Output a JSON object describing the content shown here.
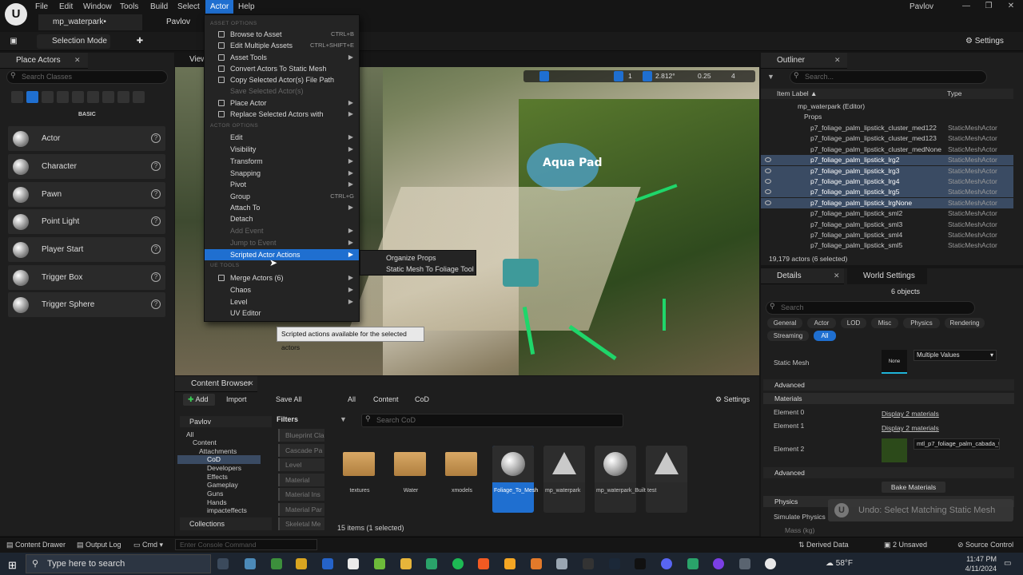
{
  "menubar": {
    "items": [
      "File",
      "Edit",
      "Window",
      "Tools",
      "Build",
      "Select",
      "Actor",
      "Help"
    ],
    "user": "Pavlov"
  },
  "tabs": {
    "level_tab": "mp_waterpark•",
    "project_tab": "Pavlov Work"
  },
  "toolbar": {
    "selection_mode": "Selection Mode",
    "settings": "Settings"
  },
  "place_actors": {
    "title": "Place Actors",
    "search_placeholder": "Search Classes",
    "category": "BASIC",
    "items": [
      "Actor",
      "Character",
      "Pawn",
      "Point Light",
      "Player Start",
      "Trigger Box",
      "Trigger Sphere"
    ]
  },
  "viewport": {
    "tab": "View",
    "snap_grid": "1",
    "angle": "2.812°",
    "scale": "0.25",
    "camera": "4"
  },
  "actor_menu": {
    "section_asset": "ASSET OPTIONS",
    "section_actor": "ACTOR OPTIONS",
    "section_ue": "UE TOOLS",
    "items": [
      {
        "label": "Browse to Asset",
        "shortcut": "CTRL+B"
      },
      {
        "label": "Edit Multiple Assets",
        "shortcut": "CTRL+SHIFT+E"
      },
      {
        "label": "Asset Tools",
        "shortcut": ""
      },
      {
        "label": "Convert Actors To Static Mesh",
        "shortcut": ""
      },
      {
        "label": "Copy Selected Actor(s) File Path",
        "shortcut": ""
      },
      {
        "label": "Save Selected Actor(s)",
        "shortcut": ""
      },
      {
        "label": "Place Actor",
        "shortcut": ""
      },
      {
        "label": "Replace Selected Actors with",
        "shortcut": ""
      },
      {
        "label": "Edit",
        "shortcut": ""
      },
      {
        "label": "Visibility",
        "shortcut": ""
      },
      {
        "label": "Transform",
        "shortcut": ""
      },
      {
        "label": "Snapping",
        "shortcut": ""
      },
      {
        "label": "Pivot",
        "shortcut": ""
      },
      {
        "label": "Group",
        "shortcut": "CTRL+G"
      },
      {
        "label": "Attach To",
        "shortcut": ""
      },
      {
        "label": "Detach",
        "shortcut": ""
      },
      {
        "label": "Add Event",
        "shortcut": ""
      },
      {
        "label": "Jump to Event",
        "shortcut": ""
      },
      {
        "label": "Scripted Actor Actions",
        "shortcut": ""
      },
      {
        "label": "Merge Actors (6)",
        "shortcut": ""
      },
      {
        "label": "Chaos",
        "shortcut": ""
      },
      {
        "label": "Level",
        "shortcut": ""
      },
      {
        "label": "UV Editor",
        "shortcut": ""
      }
    ],
    "submenu": [
      "Organize Props",
      "Static Mesh To Foliage Tool"
    ],
    "tooltip": "Scripted actions available for the selected actors"
  },
  "outliner": {
    "title": "Outliner",
    "search_placeholder": "Search...",
    "col_label": "Item Label ▲",
    "col_type": "Type",
    "root": "mp_waterpark (Editor)",
    "folder": "Props",
    "rows": [
      {
        "name": "p7_foliage_palm_lipstick_cluster_med122",
        "type": "StaticMeshActor"
      },
      {
        "name": "p7_foliage_palm_lipstick_cluster_med123",
        "type": "StaticMeshActor"
      },
      {
        "name": "p7_foliage_palm_lipstick_cluster_medNone",
        "type": "StaticMeshActor"
      },
      {
        "name": "p7_foliage_palm_lipstick_lrg2",
        "type": "StaticMeshActor"
      },
      {
        "name": "p7_foliage_palm_lipstick_lrg3",
        "type": "StaticMeshActor"
      },
      {
        "name": "p7_foliage_palm_lipstick_lrg4",
        "type": "StaticMeshActor"
      },
      {
        "name": "p7_foliage_palm_lipstick_lrg5",
        "type": "StaticMeshActor"
      },
      {
        "name": "p7_foliage_palm_lipstick_lrgNone",
        "type": "StaticMeshActor"
      },
      {
        "name": "p7_foliage_palm_lipstick_sml2",
        "type": "StaticMeshActor"
      },
      {
        "name": "p7_foliage_palm_lipstick_sml3",
        "type": "StaticMeshActor"
      },
      {
        "name": "p7_foliage_palm_lipstick_sml4",
        "type": "StaticMeshActor"
      },
      {
        "name": "p7_foliage_palm_lipstick_sml5",
        "type": "StaticMeshActor"
      }
    ],
    "footer": "19,179 actors (6 selected)"
  },
  "details": {
    "title": "Details",
    "world_settings": "World Settings",
    "objects": "6 objects",
    "search_placeholder": "Search",
    "chips": [
      "General",
      "Actor",
      "LOD",
      "Misc",
      "Physics",
      "Rendering",
      "Streaming",
      "All"
    ],
    "static_mesh_label": "Static Mesh",
    "static_mesh_thumb": "None",
    "static_mesh_value": "Multiple Values",
    "advanced": "Advanced",
    "materials": "Materials",
    "element0": "Element 0",
    "element1": "Element 1",
    "element2": "Element 2",
    "display2": "Display 2 materials",
    "element2_value": "mtl_p7_foliage_palm_cabada_t",
    "advanced2": "Advanced",
    "bake": "Bake Materials",
    "physics": "Physics",
    "simulate": "Simulate Physics",
    "mass": "Mass (kg)"
  },
  "content_browser": {
    "title": "Content Browser",
    "add": "Add",
    "import": "Import",
    "save_all": "Save All",
    "crumbs": [
      "All",
      "Content",
      "CoD"
    ],
    "settings": "Settings",
    "tree_root": "Pavlov",
    "tree": [
      "All",
      "Content",
      "Attachments",
      "CoD",
      "Developers",
      "Effects",
      "Gameplay",
      "Guns",
      "Hands",
      "impacteffects"
    ],
    "collections": "Collections",
    "filters_title": "Filters",
    "filters": [
      "Blueprint Cla",
      "Cascade Pa",
      "Level",
      "Material",
      "Material Ins",
      "Material Par",
      "Skeletal Me"
    ],
    "search_placeholder": "Search CoD",
    "assets": [
      "textures",
      "Water",
      "xmodels",
      "Foliage_To_Mesh",
      "mp_waterpark",
      "mp_waterpark_BuiltData",
      "test"
    ],
    "count": "15 items (1 selected)"
  },
  "statusbar": {
    "content_drawer": "Content Drawer",
    "output_log": "Output Log",
    "cmd": "Cmd",
    "console_placeholder": "Enter Console Command",
    "derived": "Derived Data",
    "unsaved": "2 Unsaved",
    "source": "Source Control"
  },
  "toast": "Undo: Select Matching Static Mesh",
  "taskbar": {
    "search": "Type here to search",
    "weather": "58°F",
    "time": "11:47 PM",
    "date": "4/11/2024"
  }
}
